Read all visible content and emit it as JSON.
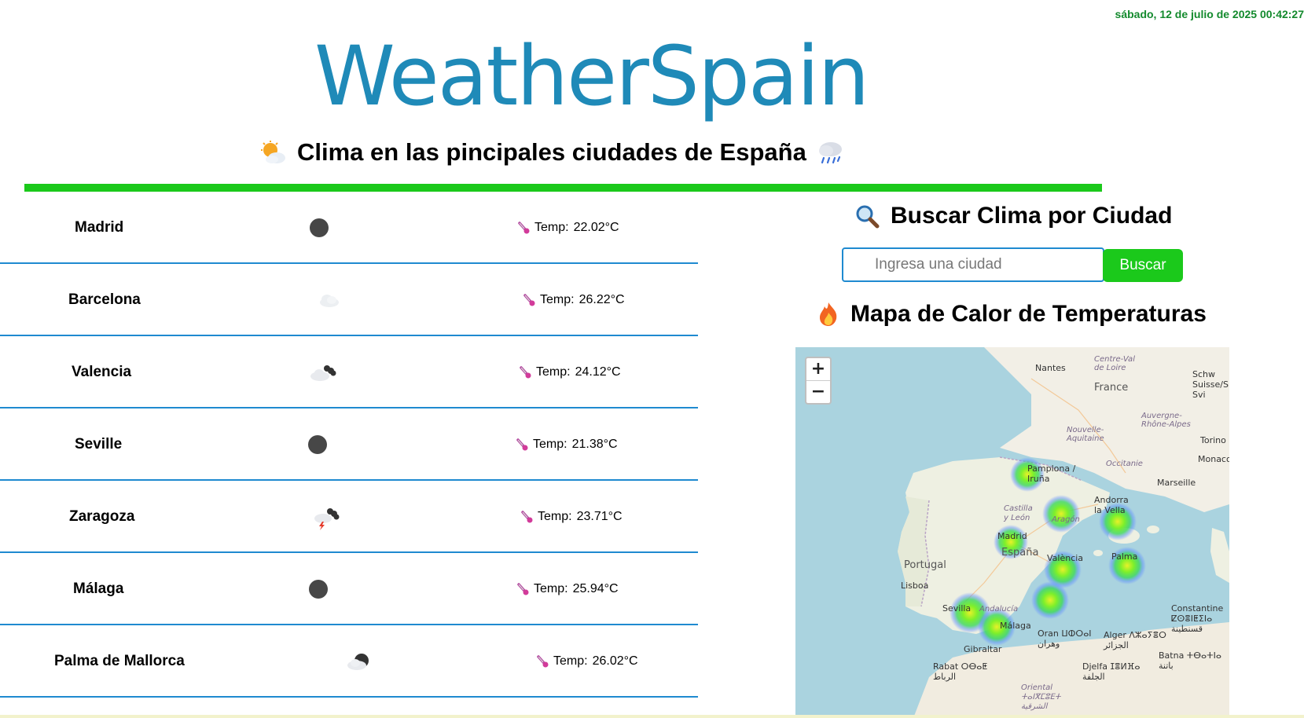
{
  "header": {
    "datetime": "sábado, 12 de julio de 2025 00:42:27",
    "brand": "WeatherSpain",
    "subtitle": "Clima en las pincipales ciudades de España",
    "subtitle_icon_left": "sun-behind-cloud-icon",
    "subtitle_icon_right": "cloud-with-rain-icon"
  },
  "colors": {
    "brand": "#1f8ab8",
    "accent_green": "#1bc91b",
    "divider_blue": "#1f8ad0",
    "datetime": "#138a2d"
  },
  "temp_prefix": "Temp:",
  "cities": [
    {
      "name": "Madrid",
      "icon": "clear-night-icon",
      "temp": "22.02°C"
    },
    {
      "name": "Barcelona",
      "icon": "few-clouds-icon",
      "temp": "26.22°C"
    },
    {
      "name": "Valencia",
      "icon": "broken-clouds-icon",
      "temp": "24.12°C"
    },
    {
      "name": "Seville",
      "icon": "clear-night-icon",
      "temp": "21.38°C"
    },
    {
      "name": "Zaragoza",
      "icon": "thunderstorm-icon",
      "temp": "23.71°C"
    },
    {
      "name": "Málaga",
      "icon": "clear-night-icon",
      "temp": "25.94°C"
    },
    {
      "name": "Palma de Mallorca",
      "icon": "night-clouds-icon",
      "temp": "26.02°C"
    }
  ],
  "search": {
    "title": "Buscar Clima por Ciudad",
    "placeholder": "Ingresa una ciudad",
    "button_label": "Buscar"
  },
  "heatmap": {
    "title": "Mapa de Calor de Temperaturas",
    "zoom_in": "+",
    "zoom_out": "−",
    "labels": {
      "nantes": "Nantes",
      "centre": "Centre-Val\nde Loire",
      "france": "France",
      "suisse": "Schw\nSuisse/S\nSvi",
      "nouvelle": "Nouvelle-\nAquitaine",
      "auvergne": "Auvergne-\nRhône-Alpes",
      "torino": "Torino",
      "monaco": "Monaco",
      "occitanie": "Occitanie",
      "marseille": "Marseille",
      "pamplona": "Pamplona /\nIruña",
      "andorra": "Andorra\nla Vella",
      "castilla": "Castilla\ny León",
      "aragon": "Aragón",
      "madrid": "Madrid",
      "espana": "España",
      "portugal": "Portugal",
      "lisboa": "Lisboa",
      "valencia": "València",
      "palma": "Palma",
      "sevilla": "Sevilla",
      "andalucia": "Andalucía",
      "malaga": "Málaga",
      "gibraltar": "Gibraltar",
      "oran": "Oran ⵡⵀⵔⴰⵏ\nوهران",
      "alger": "Alger ⴷⵣⴰⵢⴻⵔ\nالجزائر",
      "constantine": "Constantine\nⵇⵙⴻⵏⵟⵉⵏⴰ\nقسنطينة",
      "rabat": "Rabat ⵔⴱⴰⵟ\nالرباط",
      "djelfa": "Djelfa ⵊⴻⵍⴼⴰ\nالجلفة",
      "batna": "Batna ⵜⴱⴰⵜⵏⴰ\nباتنة",
      "oriental": "Oriental\nⵜⴰⵏⴳⵎⵓⴹⵜ\nالشرقية"
    }
  }
}
